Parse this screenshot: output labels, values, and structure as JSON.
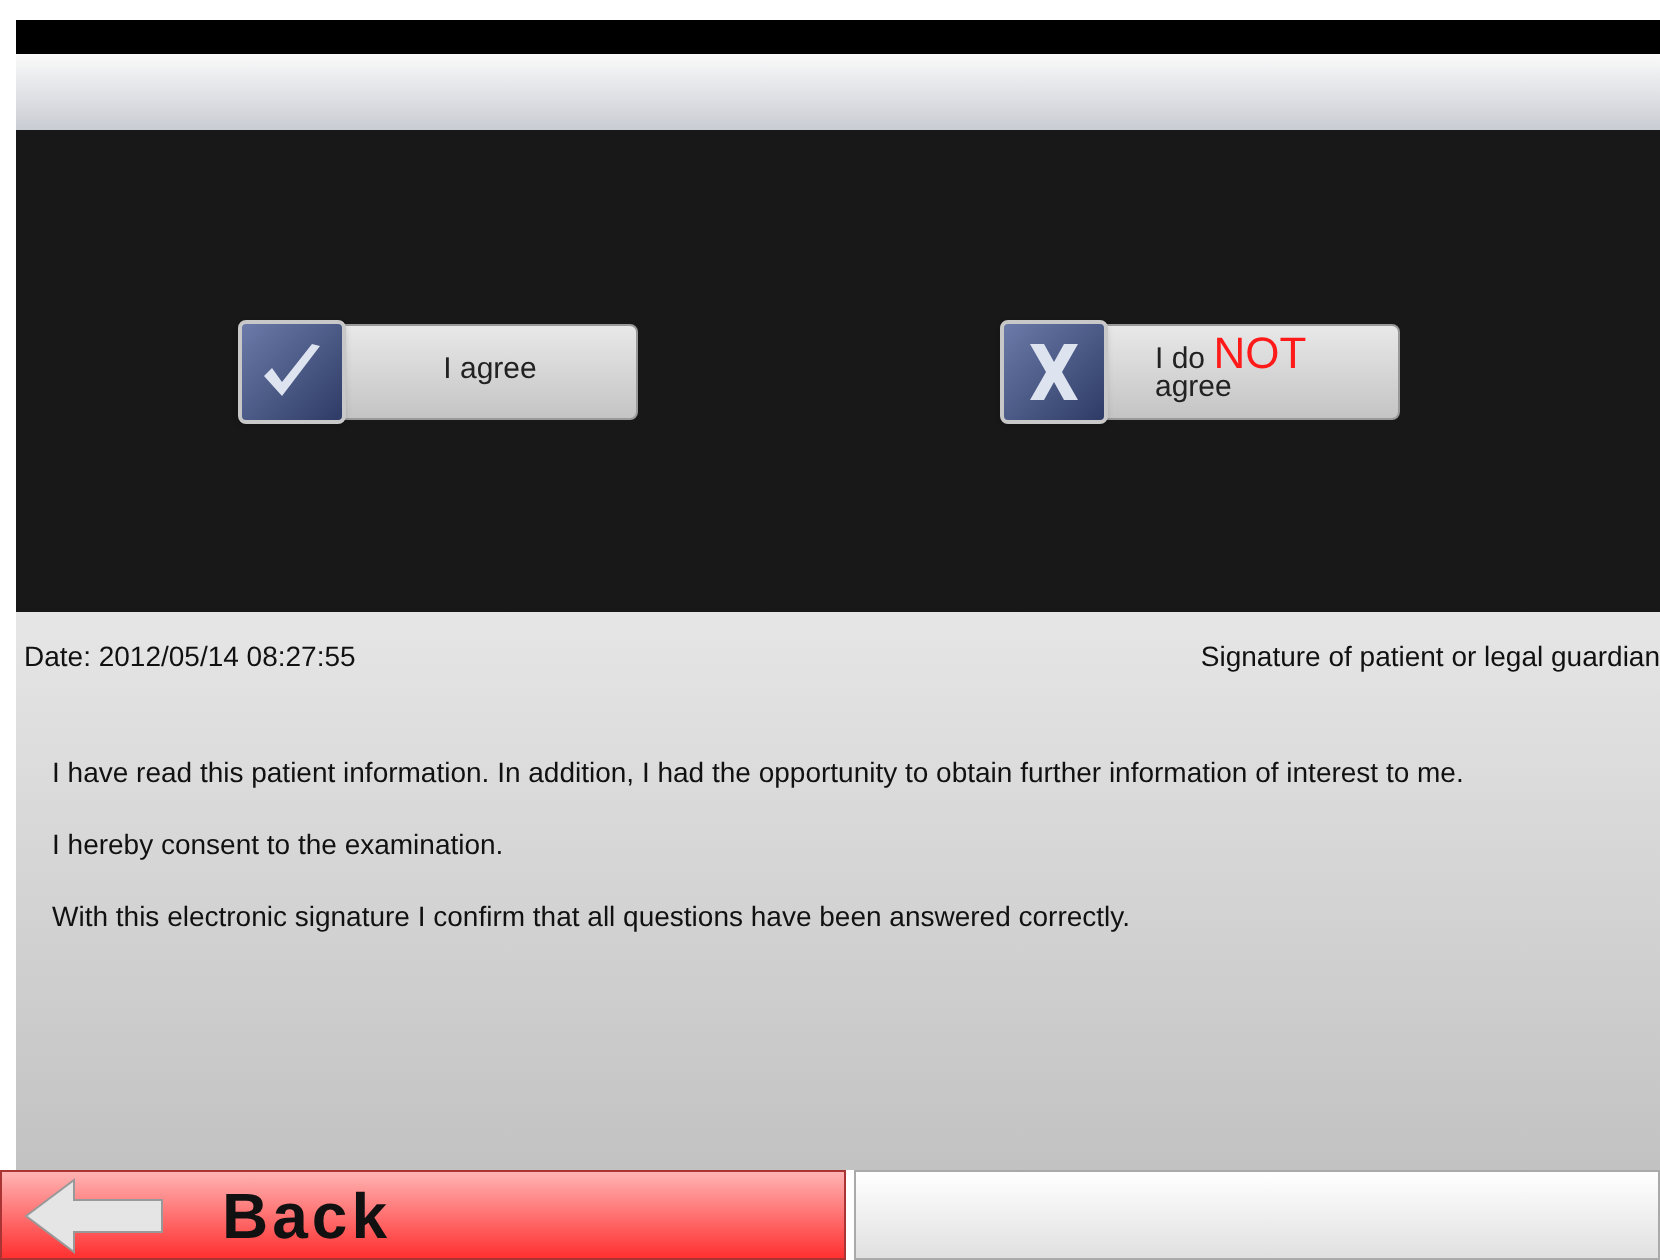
{
  "choices": [
    {
      "kind": "agree",
      "label": "I agree"
    },
    {
      "kind": "disagree",
      "label_start": "I do",
      "emphasis": "NOT",
      "label_end": "agree"
    }
  ],
  "date": "Date: 2012/05/14 08:27:55",
  "signature_label": "Signature of patient or legal guardian",
  "paragraphs": [
    "I have read this patient information. In addition, I had the opportunity to obtain further information of interest to me.",
    "I hereby consent to the examination.",
    "With this electronic signature I confirm that all questions have been answered correctly."
  ],
  "back_button": {
    "label": "Back"
  }
}
